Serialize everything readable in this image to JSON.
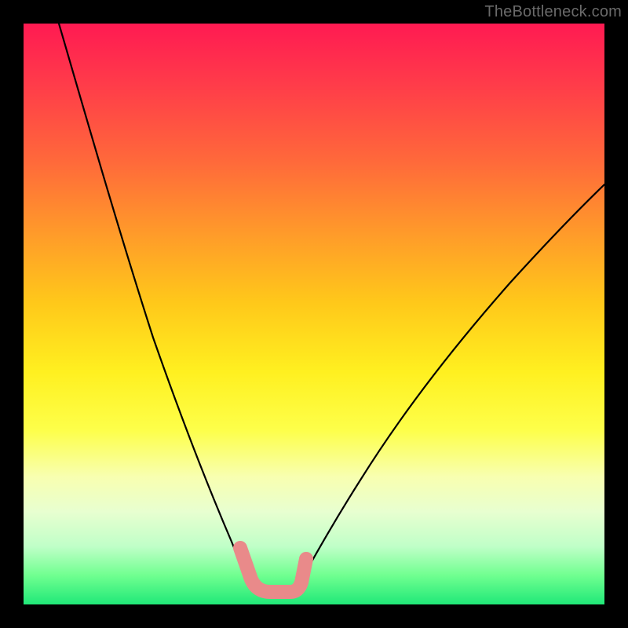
{
  "watermark": "TheBottleneck.com",
  "chart_data": {
    "type": "line",
    "title": "",
    "xlabel": "",
    "ylabel": "",
    "xlim": [
      0,
      100
    ],
    "ylim": [
      0,
      100
    ],
    "grid": false,
    "legend": false,
    "background_gradient": {
      "orientation": "vertical",
      "stops": [
        {
          "pos": 0.0,
          "color": "#ff1a52"
        },
        {
          "pos": 0.5,
          "color": "#ffd020"
        },
        {
          "pos": 0.78,
          "color": "#f8ffb0"
        },
        {
          "pos": 1.0,
          "color": "#20e878"
        }
      ]
    },
    "series": [
      {
        "name": "left-branch",
        "color": "#000000",
        "x": [
          6,
          10,
          14,
          18,
          22,
          26,
          30,
          34,
          36,
          38
        ],
        "y": [
          100,
          82,
          66,
          52,
          40,
          29,
          20,
          12,
          8,
          5
        ]
      },
      {
        "name": "right-branch",
        "color": "#000000",
        "x": [
          47,
          50,
          54,
          58,
          62,
          68,
          74,
          80,
          86,
          92,
          98,
          100
        ],
        "y": [
          4,
          7,
          12,
          17,
          22,
          29,
          36,
          43,
          50,
          57,
          64,
          66
        ]
      },
      {
        "name": "bottleneck-marker",
        "color": "#e98a8a",
        "stroke_width": 12,
        "x": [
          37,
          38,
          40,
          44,
          46,
          47,
          48
        ],
        "y": [
          10,
          5,
          3,
          3,
          4,
          6,
          11
        ]
      }
    ],
    "annotations": []
  }
}
